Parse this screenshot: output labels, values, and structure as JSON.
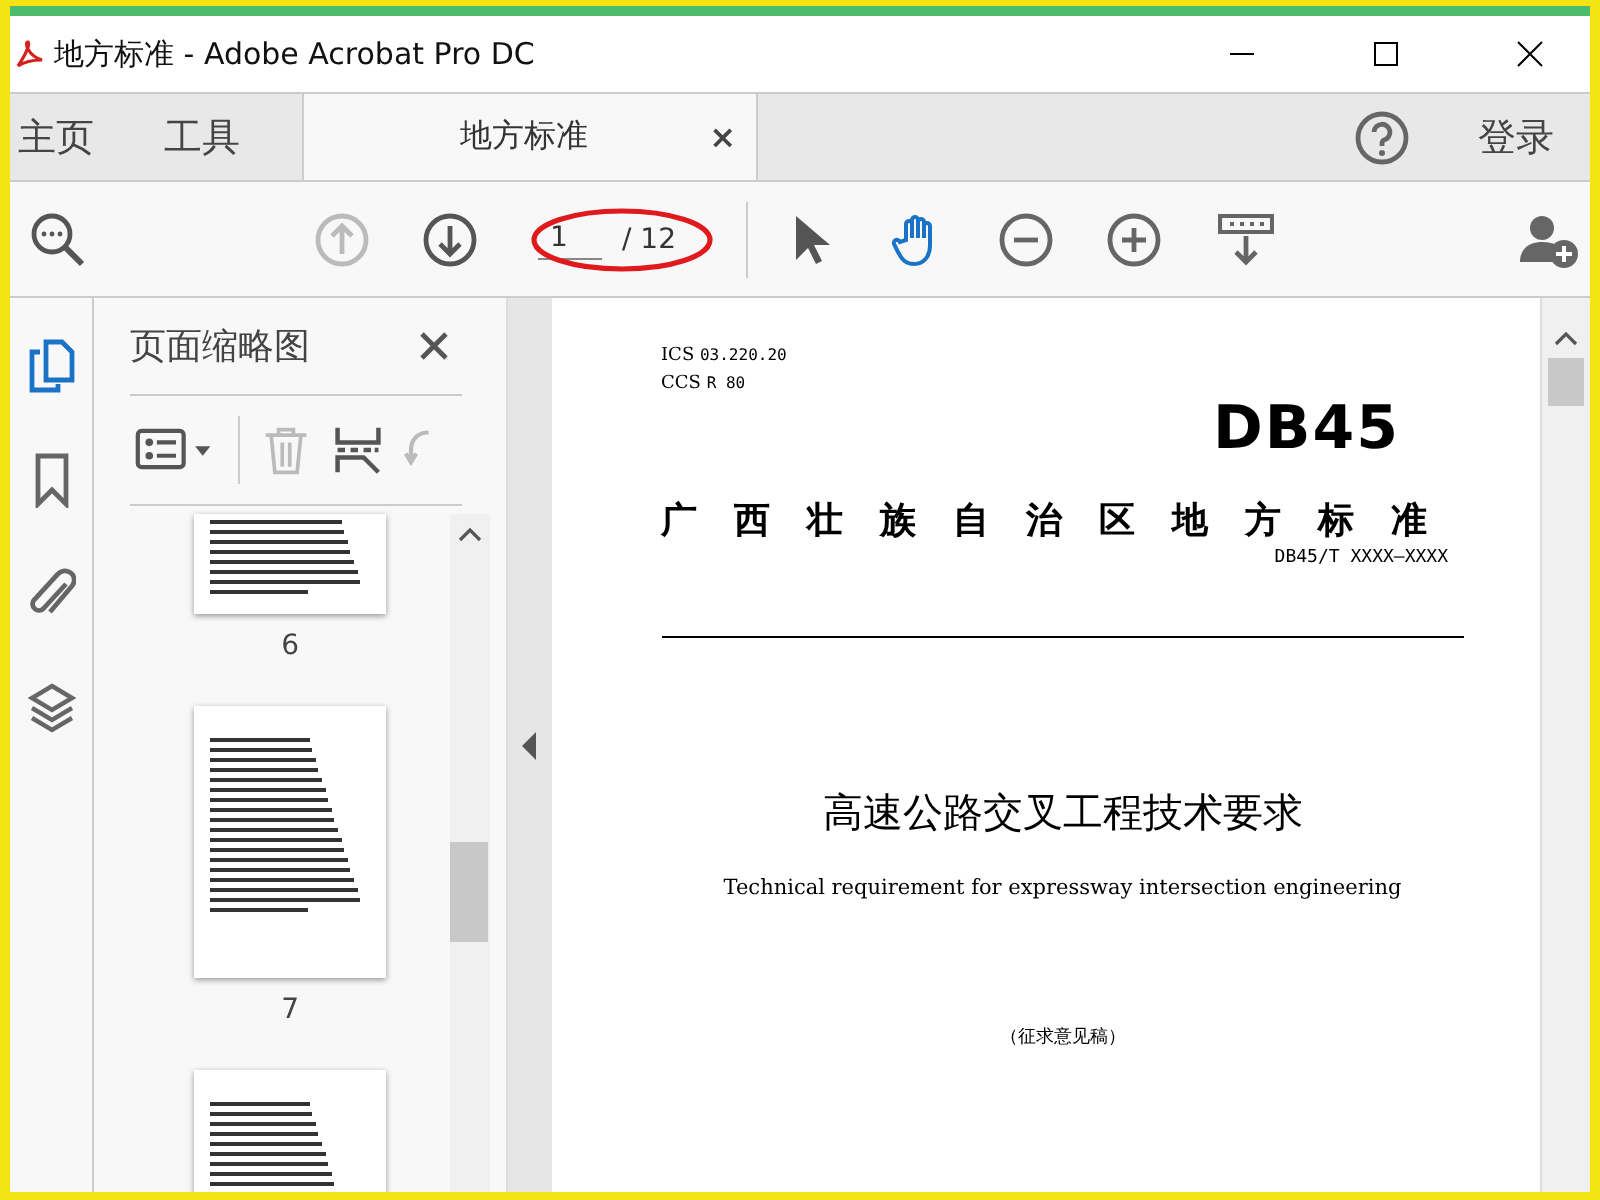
{
  "window": {
    "title": "地方标准 - Adobe Acrobat Pro DC"
  },
  "tabs": [
    {
      "label": "主页",
      "selected": false
    },
    {
      "label": "工具",
      "selected": false
    },
    {
      "label": "地方标准",
      "selected": true,
      "close": "×"
    }
  ],
  "sign_in": "登录",
  "toolbar": {
    "prev_page": {
      "disabled": true
    },
    "next_page": {
      "disabled": false
    },
    "page_number": {
      "value": "1",
      "total": "/ 12"
    },
    "select_tool": {
      "selected": false
    },
    "hand_tool": {
      "selected": true
    }
  },
  "rail": [
    {
      "kind": "pages",
      "selected": true
    },
    {
      "kind": "bookmark",
      "selected": false
    },
    {
      "kind": "attachment",
      "selected": false
    },
    {
      "kind": "layers",
      "selected": false
    }
  ],
  "panel": {
    "title": "页面缩略图",
    "tools": [
      {
        "kind": "options",
        "disabled": false
      },
      {
        "kind": "delete",
        "disabled": true
      },
      {
        "kind": "insert",
        "disabled": false
      },
      {
        "kind": "rotate",
        "disabled": true
      }
    ],
    "thumbnails": [
      {
        "label": "6",
        "cut": true
      },
      {
        "label": "7",
        "cut": false
      },
      {
        "cut": false
      }
    ]
  },
  "document": {
    "ics_label": "ICS",
    "ics": "03.220.20",
    "ccs_label": "CCS",
    "ccs": "R 80",
    "logo": "DB45",
    "heading": "广西壮族自治区地方标准",
    "code": "DB45/T XXXX—XXXX",
    "title": "高速公路交叉工程技术要求",
    "subtitle": "Technical requirement for expressway intersection engineering",
    "draft": "（征求意见稿）"
  }
}
